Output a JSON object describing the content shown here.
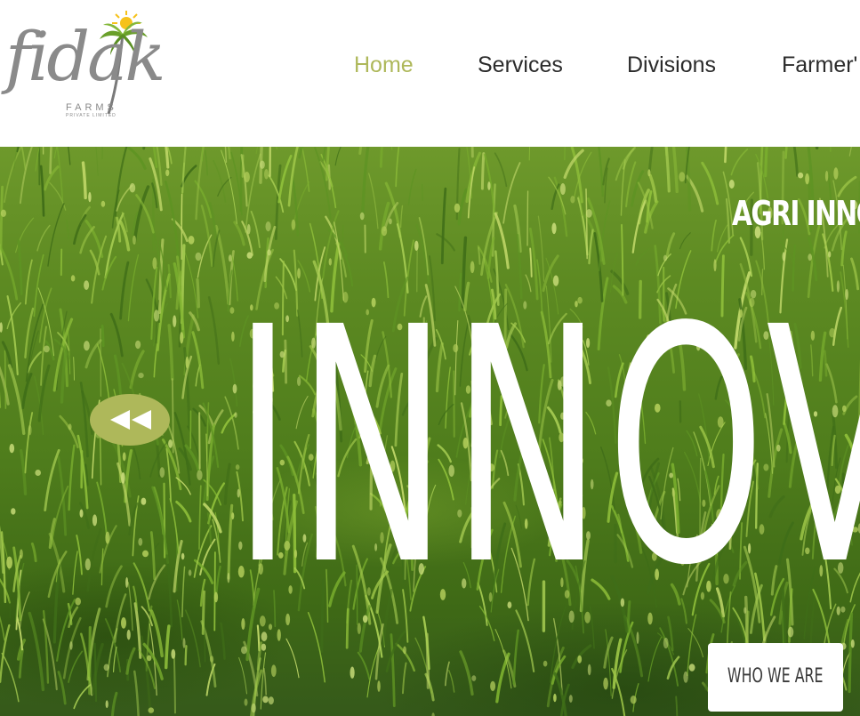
{
  "brand": {
    "name": "fidak",
    "sub1": "FARMS",
    "sub2": "PRIVATE LIMITED",
    "logo_icon": "palm-sun-icon",
    "accent": "#aeb85a"
  },
  "nav": {
    "items": [
      {
        "label": "Home",
        "active": true
      },
      {
        "label": "Services",
        "active": false
      },
      {
        "label": "Divisions",
        "active": false
      },
      {
        "label": "Farmer'"
      }
    ]
  },
  "hero": {
    "tagline": "AGRI INNO",
    "headline": "INNOV",
    "prev_icon": "rewind-icon",
    "cta_label": "WHO WE ARE"
  },
  "colors": {
    "accent": "#aeb85a",
    "nav_text": "#2b2b2b",
    "cta_text": "#3a3a3a",
    "hero_text": "#ffffff"
  }
}
